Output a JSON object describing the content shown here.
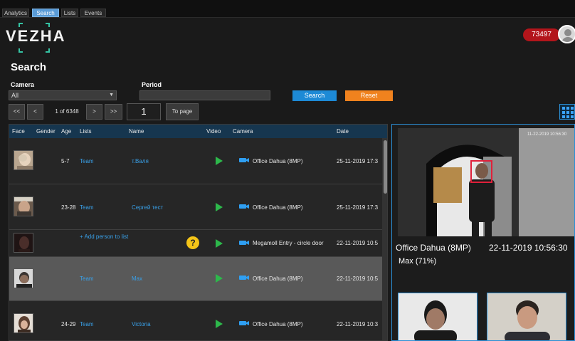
{
  "tabs": [
    {
      "label": "Analytics",
      "active": false
    },
    {
      "label": "Search",
      "active": true
    },
    {
      "label": "Lists",
      "active": false
    },
    {
      "label": "Events",
      "active": false
    }
  ],
  "logo": {
    "text": "VEZHA",
    "bracket_color": "#35c4a4"
  },
  "header": {
    "notification_count": "73497",
    "avatar_icon": "user-icon"
  },
  "page_title": "Search",
  "filters": {
    "camera_label": "Camera",
    "camera_value": "All",
    "period_label": "Period",
    "period_value": "",
    "search_label": "Search",
    "reset_label": "Reset"
  },
  "pagination": {
    "first": "<<",
    "prev": "<",
    "info": "1 of 6348",
    "next": ">",
    "last": ">>",
    "page_input": "1",
    "goto_label": "To page"
  },
  "table": {
    "columns": [
      "Face",
      "Gender",
      "Age",
      "Lists",
      "Name",
      "Video",
      "Camera",
      "Date"
    ],
    "rows": [
      {
        "gender": "",
        "age": "5-7",
        "lists": "Team",
        "name": "т.Валя",
        "camera": "Office Dahua (8MP)",
        "date": "25-11-2019 17:3",
        "unknown": false,
        "selected": false
      },
      {
        "gender": "",
        "age": "23-28",
        "lists": "Team",
        "name": "Сергей тест",
        "camera": "Office Dahua (8MP)",
        "date": "25-11-2019 17:3",
        "unknown": false,
        "selected": false
      },
      {
        "gender": "",
        "age": "",
        "lists": "+ Add person to list",
        "name": "",
        "camera": "Megamoll Entry - circle door",
        "date": "22-11-2019 10:5",
        "unknown": true,
        "selected": false
      },
      {
        "gender": "",
        "age": "",
        "lists": "Team",
        "name": "Max",
        "camera": "Office Dahua (8MP)",
        "date": "22-11-2019 10:5",
        "unknown": false,
        "selected": true
      },
      {
        "gender": "",
        "age": "24-29",
        "lists": "Team",
        "name": "Victoria",
        "camera": "Office Dahua (8MP)",
        "date": "22-11-2019 10:3",
        "unknown": false,
        "selected": false
      }
    ]
  },
  "detail": {
    "camera": "Office Dahua (8MP)",
    "datetime": "22-11-2019 10:56:30",
    "person": "Max (71%)",
    "overlay_time": "11-22-2019 10:56:30"
  },
  "colors": {
    "accent": "#2b8fd6",
    "search_button": "#1d8ad6",
    "reset_button": "#f0821e",
    "notification": "#b3151b",
    "link": "#39a0e8",
    "play": "#2db84b",
    "unknown_badge": "#f5c518"
  }
}
